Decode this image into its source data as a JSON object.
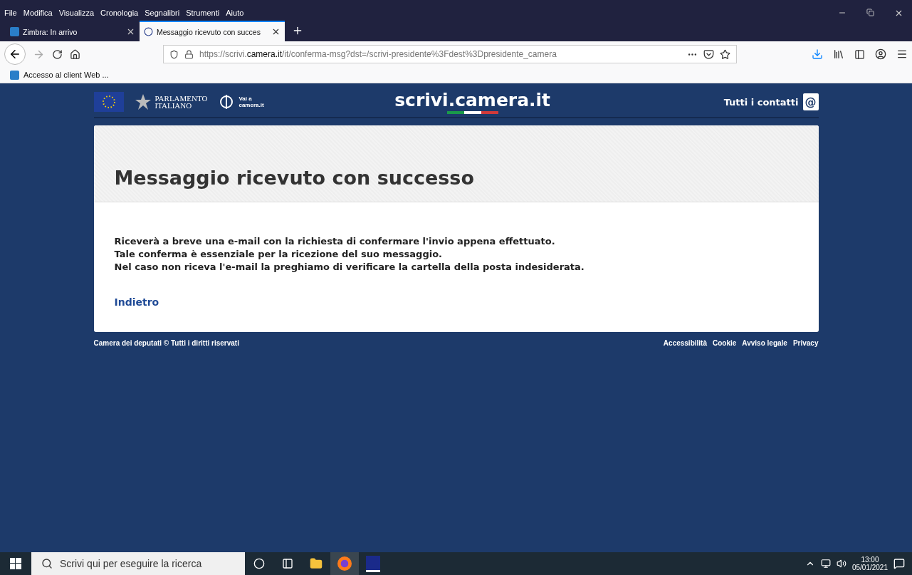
{
  "menu_bar": [
    "File",
    "Modifica",
    "Visualizza",
    "Cronologia",
    "Segnalibri",
    "Strumenti",
    "Aiuto"
  ],
  "tabs": [
    {
      "label": "Zimbra: In arrivo",
      "selected": false
    },
    {
      "label": "Messaggio ricevuto con succes",
      "selected": true
    }
  ],
  "address_bar": {
    "url_prefix": "https://scrivi.",
    "url_domain": "camera.it",
    "url_rest": "/it/conferma-msg?dst=/scrivi-presidente%3Fdest%3Dpresidente_camera"
  },
  "bookmarks": [
    "Accesso al client Web ..."
  ],
  "site_header": {
    "parliament_line1": "PARLAMENTO",
    "parliament_line2": "ITALIANO",
    "link_line1": "Vai a",
    "link_line2": "camera.it",
    "site_title": "scrivi.camera.it",
    "contacts": "Tutti i contatti",
    "contacts_icon": "@"
  },
  "card": {
    "title": "Messaggio ricevuto con successo",
    "lines": [
      "Riceverà a breve una e-mail con la richiesta di confermare l'invio appena effettuato.",
      "Tale conferma è essenziale per la ricezione del suo messaggio.",
      "Nel caso non riceva l'e-mail la preghiamo di verificare la cartella della posta indesiderata."
    ],
    "back_link": "Indietro"
  },
  "footer": {
    "copyright": "Camera dei deputati © Tutti i diritti riservati",
    "links": [
      "Accessibilità",
      "Cookie",
      "Avviso legale",
      "Privacy"
    ]
  },
  "taskbar": {
    "search_placeholder": "Scrivi qui per eseguire la ricerca",
    "time": "13:00",
    "date": "05/01/2021"
  }
}
